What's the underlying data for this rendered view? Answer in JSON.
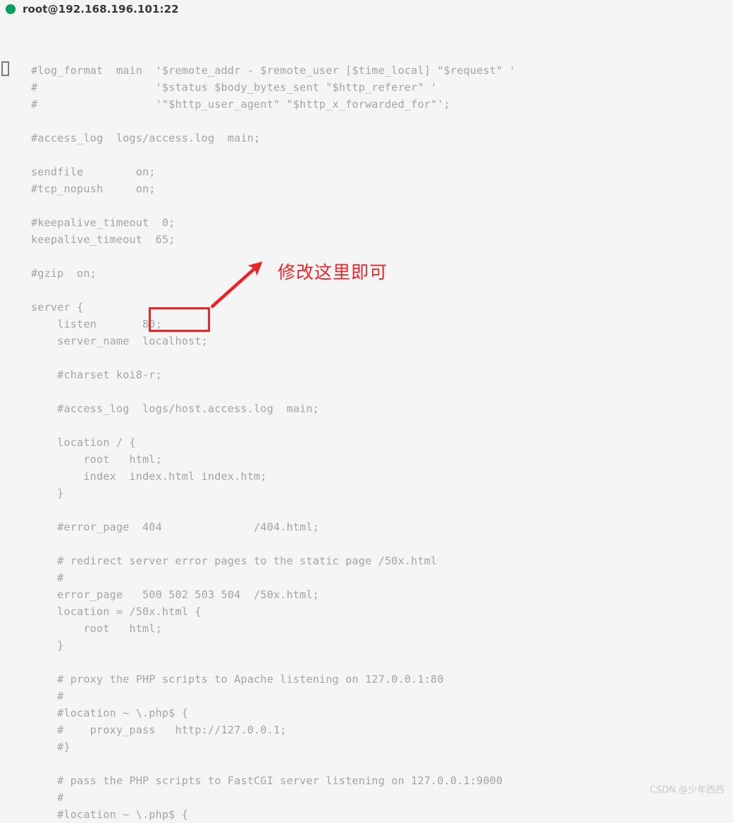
{
  "window": {
    "title": "root@192.168.196.101:22",
    "status_dot_color": "#00a05a",
    "status_dot_name": "connection-status-dot",
    "background_color": "#f5f5f5",
    "text_color": "#a6a4a2"
  },
  "terminal": {
    "cursor_glyph": "",
    "code": "#log_format  main  '$remote_addr - $remote_user [$time_local] \"$request\" '\n#                  '$status $body_bytes_sent \"$http_referer\" '\n#                  '\"$http_user_agent\" \"$http_x_forwarded_for\"';\n\n#access_log  logs/access.log  main;\n\nsendfile        on;\n#tcp_nopush     on;\n\n#keepalive_timeout  0;\nkeepalive_timeout  65;\n\n#gzip  on;\n\nserver {\n    listen       80;\n    server_name  localhost;\n\n    #charset koi8-r;\n\n    #access_log  logs/host.access.log  main;\n\n    location / {\n        root   html;\n        index  index.html index.htm;\n    }\n\n    #error_page  404              /404.html;\n\n    # redirect server error pages to the static page /50x.html\n    #\n    error_page   500 502 503 504  /50x.html;\n    location = /50x.html {\n        root   html;\n    }\n\n    # proxy the PHP scripts to Apache listening on 127.0.0.1:80\n    #\n    #location ~ \\.php$ {\n    #    proxy_pass   http://127.0.0.1;\n    #}\n\n    # pass the PHP scripts to FastCGI server listening on 127.0.0.1:9000\n    #\n    #location ~ \\.php$ {"
  },
  "annotation": {
    "text": "修改这里即可",
    "color": "#e8262a",
    "highlight_value": "80;",
    "highlight_target_line": "listen       80;"
  },
  "watermark": {
    "text": "CSDN @少年西西"
  }
}
